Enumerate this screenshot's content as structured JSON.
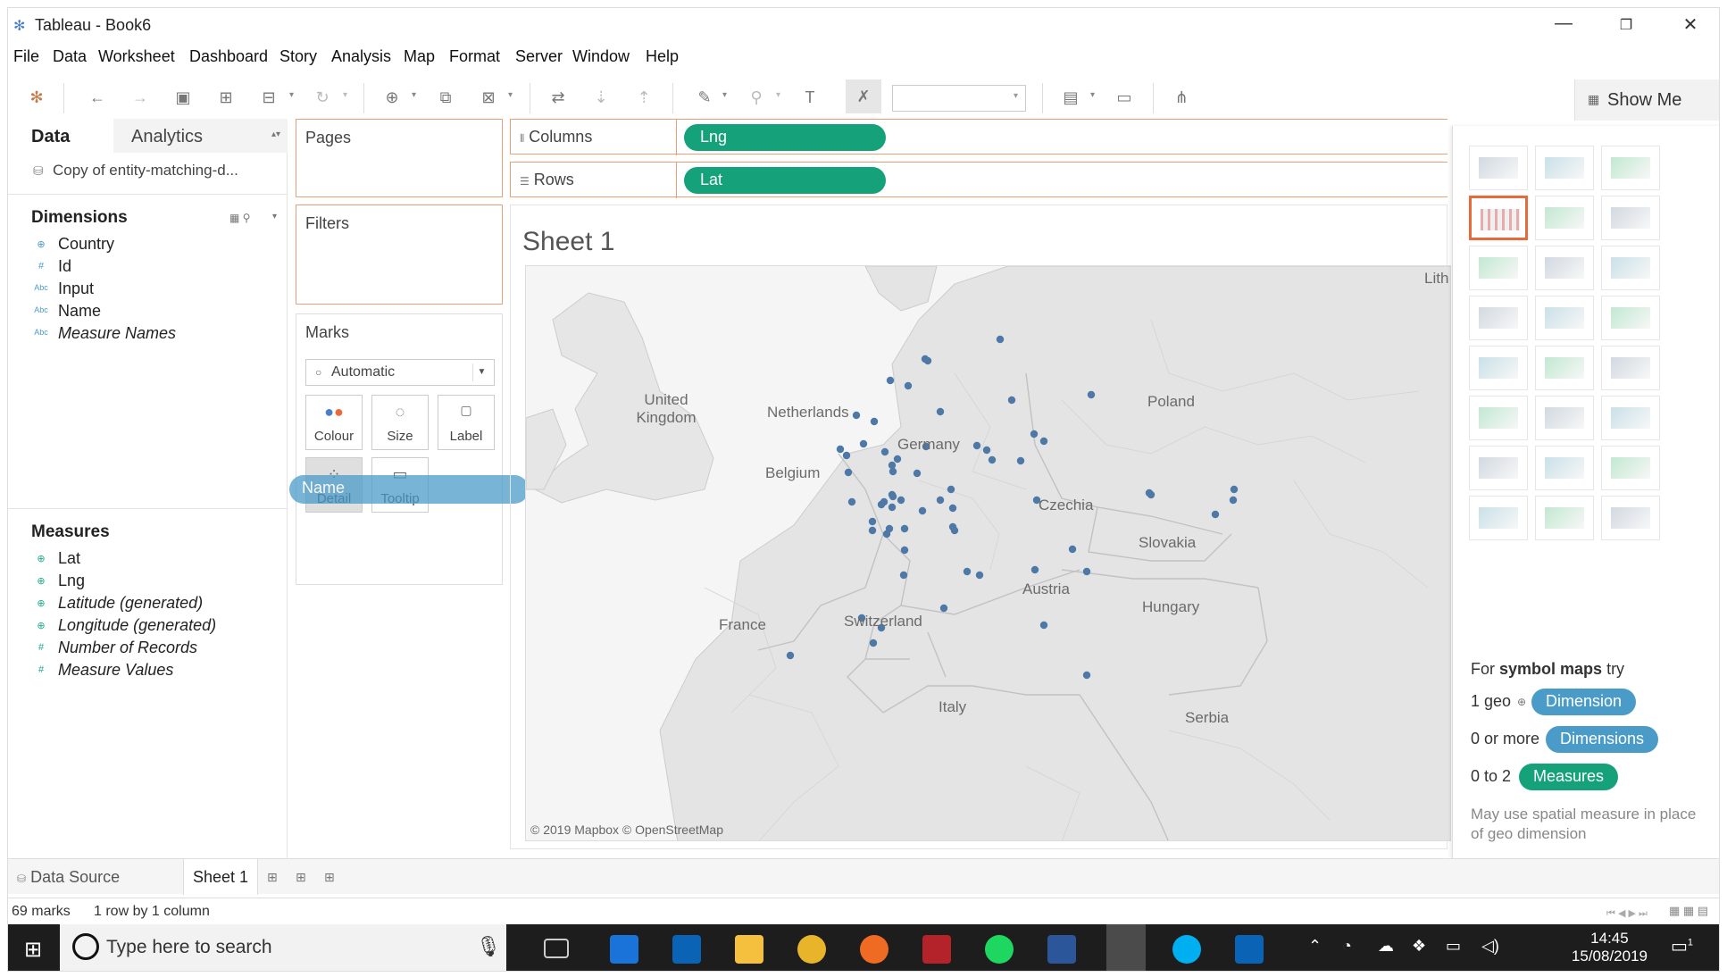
{
  "window": {
    "title": "Tableau - Book6"
  },
  "menu": [
    "File",
    "Data",
    "Worksheet",
    "Dashboard",
    "Story",
    "Analysis",
    "Map",
    "Format",
    "Server",
    "Window",
    "Help"
  ],
  "toolbar": {
    "show_me_label": "Show Me"
  },
  "data_pane": {
    "tab_data": "Data",
    "tab_analytics": "Analytics",
    "datasource": "Copy of entity-matching-d...",
    "dimensions_title": "Dimensions",
    "dimensions": [
      {
        "name": "Country",
        "type": "geo",
        "italic": false
      },
      {
        "name": "Id",
        "type": "number",
        "italic": false
      },
      {
        "name": "Input",
        "type": "string",
        "italic": false
      },
      {
        "name": "Name",
        "type": "string",
        "italic": false
      },
      {
        "name": "Measure Names",
        "type": "string",
        "italic": true
      }
    ],
    "measures_title": "Measures",
    "measures": [
      {
        "name": "Lat",
        "type": "geo",
        "italic": false
      },
      {
        "name": "Lng",
        "type": "geo",
        "italic": false
      },
      {
        "name": "Latitude (generated)",
        "type": "geo",
        "italic": true
      },
      {
        "name": "Longitude (generated)",
        "type": "geo",
        "italic": true
      },
      {
        "name": "Number of Records",
        "type": "number",
        "italic": true
      },
      {
        "name": "Measure Values",
        "type": "number",
        "italic": true
      }
    ]
  },
  "pages": {
    "title": "Pages"
  },
  "filters": {
    "title": "Filters"
  },
  "marks": {
    "title": "Marks",
    "type": "Automatic",
    "buttons": [
      "Colour",
      "Size",
      "Label",
      "Detail",
      "Tooltip"
    ],
    "drag_pill": "Name"
  },
  "shelves": {
    "columns_label": "Columns",
    "columns_pill": "Lng",
    "rows_label": "Rows",
    "rows_pill": "Lat"
  },
  "sheet": {
    "title": "Sheet 1",
    "attribution": "© 2019 Mapbox © OpenStreetMap",
    "map_labels": [
      "United Kingdom",
      "Netherlands",
      "Belgium",
      "Germany",
      "Poland",
      "Czechia",
      "Slovakia",
      "Austria",
      "Hungary",
      "France",
      "Switzerland",
      "Italy",
      "Serbia",
      "Lith"
    ]
  },
  "show_me": {
    "hint_prefix": "For ",
    "hint_bold": "symbol maps",
    "hint_suffix": " try",
    "req1_label": "1 geo",
    "req1_pill": "Dimension",
    "req2_label": "0 or more",
    "req2_pill": "Dimensions",
    "req3_label": "0 to 2",
    "req3_pill": "Measures",
    "note": "May use spatial measure in place of geo dimension"
  },
  "bottom_tabs": {
    "datasource": "Data Source",
    "sheet": "Sheet 1"
  },
  "status": {
    "marks": "69 marks",
    "dims": "1 row by 1 column"
  },
  "taskbar": {
    "search_placeholder": "Type here to search",
    "time": "14:45",
    "date": "15/08/2019",
    "notif_count": "1"
  }
}
